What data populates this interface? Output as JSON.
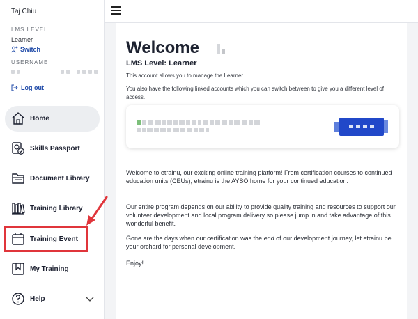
{
  "sidebar": {
    "user_name": "Taj Chiu",
    "lms_level_label": "LMS LEVEL",
    "lms_level_value": "Learner",
    "switch_label": "Switch",
    "username_label": "USERNAME",
    "logout_label": "Log out",
    "items": [
      {
        "label": "Home",
        "icon": "home-icon",
        "active": true
      },
      {
        "label": "Skills Passport",
        "icon": "passport-icon"
      },
      {
        "label": "Document Library",
        "icon": "folder-icon"
      },
      {
        "label": "Training Library",
        "icon": "library-icon"
      },
      {
        "label": "Training Event",
        "icon": "calendar-icon"
      },
      {
        "label": "My Training",
        "icon": "bookmark-icon"
      },
      {
        "label": "Help",
        "icon": "question-icon"
      }
    ]
  },
  "main": {
    "welcome_title": "Welcome",
    "level_heading": "LMS Level: Learner",
    "account_desc": "This account allows you to manage the Learner.",
    "linked_desc": "You also have the following linked accounts which you can switch between to give you a different level of access.",
    "para1": "Welcome to etrainu, our exciting online training platform! From certification courses to continued education units (CEUs), etrainu is the AYSO home for your continued education.",
    "para2": "Our entire program depends on our ability to provide quality training and resources to support our volunteer development and local program delivery so please jump in and take advantage of this wonderful benefit.",
    "para3_before": "Gone are the days when our certification was the ",
    "para3_em": "end",
    "para3_after": " of our development journey, let etrainu be your orchard for personal development.",
    "para4": "Enjoy!"
  },
  "colors": {
    "accent_blue": "#2148c9",
    "link_blue": "#1f4aa8",
    "annotation_red": "#e0353b"
  }
}
